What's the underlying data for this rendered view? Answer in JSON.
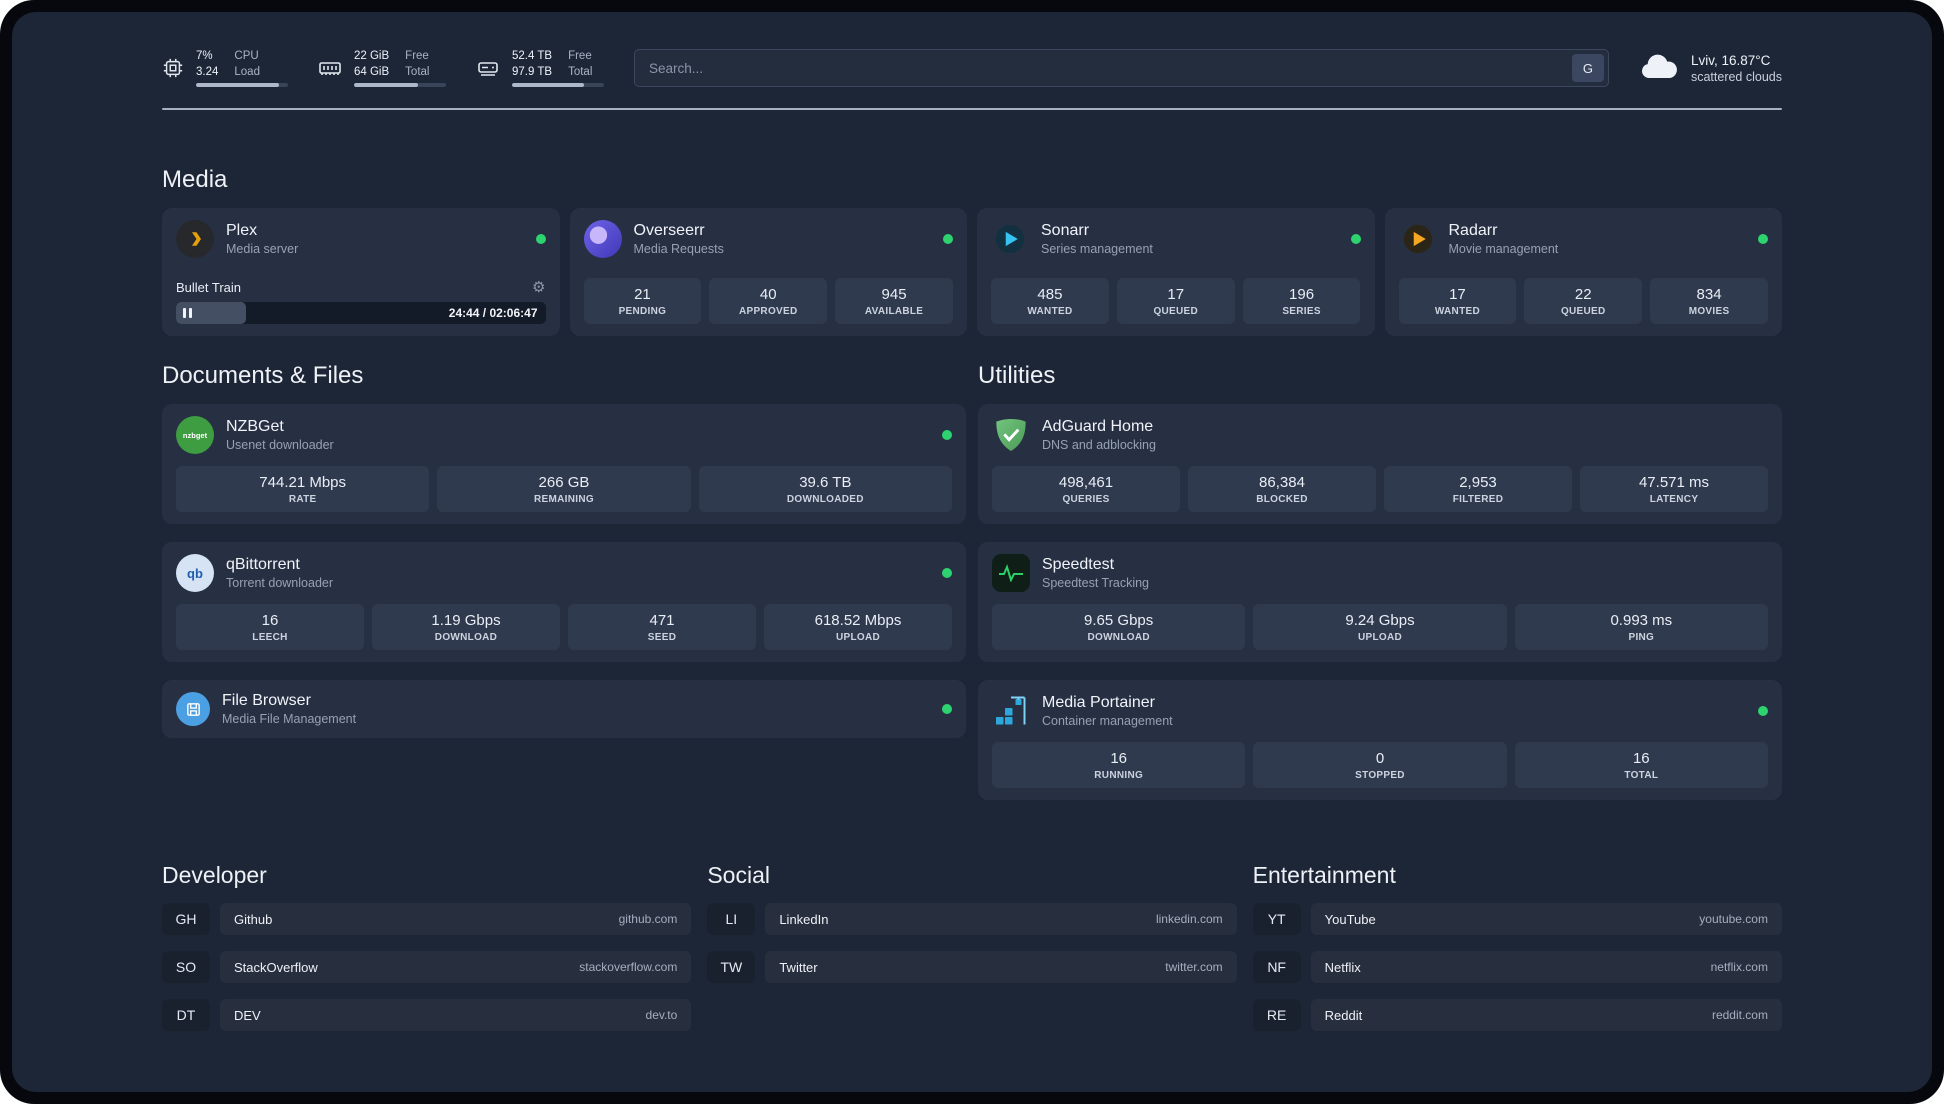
{
  "topbar": {
    "cpu": {
      "value1": "7%",
      "value2": "3.24",
      "label1": "CPU",
      "label2": "Load",
      "bar_percent": 90
    },
    "ram": {
      "value1": "22 GiB",
      "value2": "64 GiB",
      "label1": "Free",
      "label2": "Total",
      "bar_percent": 70
    },
    "disk": {
      "value1": "52.4 TB",
      "value2": "97.9 TB",
      "label1": "Free",
      "label2": "Total",
      "bar_percent": 78
    },
    "search": {
      "placeholder": "Search...",
      "button_label": "G"
    },
    "weather": {
      "location": "Lviv, 16.87°C",
      "condition": "scattered clouds"
    }
  },
  "sections": {
    "media": {
      "title": "Media",
      "plex": {
        "name": "Plex",
        "subtitle": "Media server",
        "player": {
          "title": "Bullet Train",
          "time": "24:44 / 02:06:47",
          "progress_percent": 19
        }
      },
      "overseerr": {
        "name": "Overseerr",
        "subtitle": "Media Requests",
        "stats": [
          {
            "value": "21",
            "label": "PENDING"
          },
          {
            "value": "40",
            "label": "APPROVED"
          },
          {
            "value": "945",
            "label": "AVAILABLE"
          }
        ]
      },
      "sonarr": {
        "name": "Sonarr",
        "subtitle": "Series management",
        "stats": [
          {
            "value": "485",
            "label": "WANTED"
          },
          {
            "value": "17",
            "label": "QUEUED"
          },
          {
            "value": "196",
            "label": "SERIES"
          }
        ]
      },
      "radarr": {
        "name": "Radarr",
        "subtitle": "Movie management",
        "stats": [
          {
            "value": "17",
            "label": "WANTED"
          },
          {
            "value": "22",
            "label": "QUEUED"
          },
          {
            "value": "834",
            "label": "MOVIES"
          }
        ]
      }
    },
    "documents": {
      "title": "Documents & Files",
      "nzbget": {
        "name": "NZBGet",
        "subtitle": "Usenet downloader",
        "icon_text": "nzbget",
        "stats": [
          {
            "value": "744.21 Mbps",
            "label": "RATE"
          },
          {
            "value": "266 GB",
            "label": "REMAINING"
          },
          {
            "value": "39.6 TB",
            "label": "DOWNLOADED"
          }
        ]
      },
      "qbittorrent": {
        "name": "qBittorrent",
        "subtitle": "Torrent downloader",
        "icon_text": "qb",
        "stats": [
          {
            "value": "16",
            "label": "LEECH"
          },
          {
            "value": "1.19 Gbps",
            "label": "DOWNLOAD"
          },
          {
            "value": "471",
            "label": "SEED"
          },
          {
            "value": "618.52 Mbps",
            "label": "UPLOAD"
          }
        ]
      },
      "filebrowser": {
        "name": "File Browser",
        "subtitle": "Media File Management"
      }
    },
    "utilities": {
      "title": "Utilities",
      "adguard": {
        "name": "AdGuard Home",
        "subtitle": "DNS and adblocking",
        "stats": [
          {
            "value": "498,461",
            "label": "QUERIES"
          },
          {
            "value": "86,384",
            "label": "BLOCKED"
          },
          {
            "value": "2,953",
            "label": "FILTERED"
          },
          {
            "value": "47.571 ms",
            "label": "LATENCY"
          }
        ]
      },
      "speedtest": {
        "name": "Speedtest",
        "subtitle": "Speedtest Tracking",
        "stats": [
          {
            "value": "9.65 Gbps",
            "label": "DOWNLOAD"
          },
          {
            "value": "9.24 Gbps",
            "label": "UPLOAD"
          },
          {
            "value": "0.993 ms",
            "label": "PING"
          }
        ]
      },
      "portainer": {
        "name": "Media Portainer",
        "subtitle": "Container management",
        "stats": [
          {
            "value": "16",
            "label": "RUNNING"
          },
          {
            "value": "0",
            "label": "STOPPED"
          },
          {
            "value": "16",
            "label": "TOTAL"
          }
        ]
      }
    },
    "bookmarks": [
      {
        "title": "Developer",
        "items": [
          {
            "abbr": "GH",
            "name": "Github",
            "url": "github.com"
          },
          {
            "abbr": "SO",
            "name": "StackOverflow",
            "url": "stackoverflow.com"
          },
          {
            "abbr": "DT",
            "name": "DEV",
            "url": "dev.to"
          }
        ]
      },
      {
        "title": "Social",
        "items": [
          {
            "abbr": "LI",
            "name": "LinkedIn",
            "url": "linkedin.com"
          },
          {
            "abbr": "TW",
            "name": "Twitter",
            "url": "twitter.com"
          }
        ]
      },
      {
        "title": "Entertainment",
        "items": [
          {
            "abbr": "YT",
            "name": "YouTube",
            "url": "youtube.com"
          },
          {
            "abbr": "NF",
            "name": "Netflix",
            "url": "netflix.com"
          },
          {
            "abbr": "RE",
            "name": "Reddit",
            "url": "reddit.com"
          }
        ]
      }
    ]
  },
  "colors": {
    "status_green": "#2dd36f",
    "plex_accent": "#e5a00d"
  }
}
